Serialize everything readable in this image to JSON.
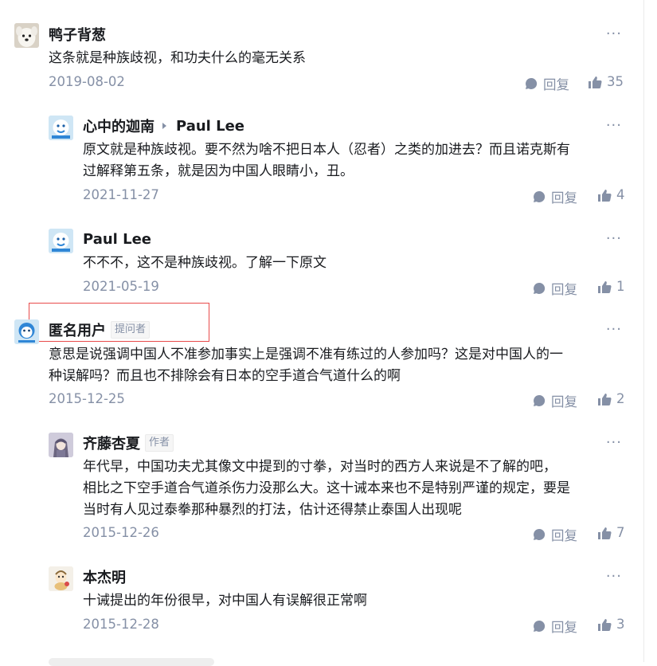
{
  "comments": [
    {
      "author": "鸭子背葱",
      "content": "这条就是种族歧视，和功夫什么的毫无关系",
      "date": "2019-08-02",
      "reply_label": "回复",
      "likes": "35"
    },
    {
      "author": "心中的迦南",
      "reply_to": "Paul Lee",
      "content_lines": [
        "原文就是种族歧视。要不然为啥不把日本人（忍者）之类的加进去？而且诺克斯有",
        "过解释第五条，就是因为中国人眼睛小，丑。"
      ],
      "date": "2021-11-27",
      "reply_label": "回复",
      "likes": "4"
    },
    {
      "author": "Paul Lee",
      "content": "不不不，这不是种族歧视。了解一下原文",
      "date": "2021-05-19",
      "reply_label": "回复",
      "likes": "1"
    },
    {
      "author": "匿名用户",
      "badge": "提问者",
      "content_lines": [
        "意思是说强调中国人不准参加事实上是强调不准有练过的人参加吗？这是对中国人的一",
        "种误解吗？而且也不排除会有日本的空手道合气道什么的啊"
      ],
      "date": "2015-12-25",
      "reply_label": "回复",
      "likes": "2"
    },
    {
      "author": "齐藤杏夏",
      "badge": "作者",
      "content_lines": [
        "年代早，中国功夫尤其像文中提到的寸拳，对当时的西方人来说是不了解的吧，",
        "相比之下空手道合气道杀伤力没那么大。这十诫本来也不是特别严谨的规定，要是",
        "当时有人见过泰拳那种暴烈的打法，估计还得禁止泰国人出现呢"
      ],
      "date": "2015-12-26",
      "reply_label": "回复",
      "likes": "7"
    },
    {
      "author": "本杰明",
      "content": "十诫提出的年份很早，对中国人有误解很正常啊",
      "date": "2015-12-28",
      "reply_label": "回复",
      "likes": "3"
    }
  ],
  "more_glyph": "···",
  "icons": {
    "reply": "chat-bubble-icon",
    "like": "thumbs-up-icon",
    "more": "more-dots-icon"
  },
  "colors": {
    "text": "#191b1f",
    "meta": "#8590a6",
    "highlight": "#e84b4b"
  }
}
